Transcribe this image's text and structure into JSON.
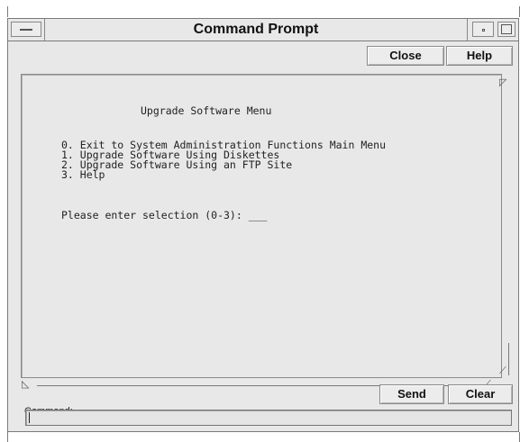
{
  "window": {
    "title": "Command Prompt",
    "buttons": {
      "close": "Close",
      "help": "Help"
    }
  },
  "terminal": {
    "title": "Upgrade Software Menu",
    "options": [
      "0. Exit to System Administration Functions Main Menu",
      "1. Upgrade Software Using Diskettes",
      "2. Upgrade Software Using an FTP Site",
      "3. Help"
    ],
    "prompt": "Please enter selection (0-3): ___"
  },
  "command": {
    "label": "Command:",
    "value": "",
    "send": "Send",
    "clear": "Clear"
  },
  "icons": {
    "window_menu": "window-menu-icon",
    "minimize": "minimize-icon",
    "maximize": "maximize-icon"
  }
}
